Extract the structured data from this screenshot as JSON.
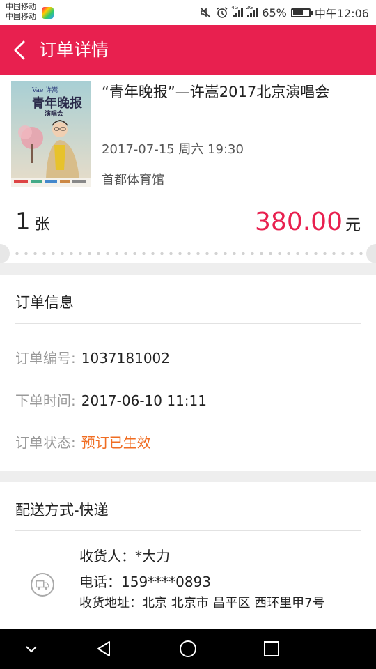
{
  "status_bar": {
    "carrier_1": "中国移动",
    "carrier_2": "中国移动",
    "network_1": "4G",
    "network_2": "2G",
    "battery_text": "65%",
    "battery_level": 0.65,
    "time": "中午12:06",
    "icons": [
      "mute-icon",
      "alarm-icon",
      "signal-icon",
      "battery-icon"
    ]
  },
  "header": {
    "title": "订单详情",
    "back_icon": "chevron-left-icon"
  },
  "event": {
    "poster_text_1": "Vae 许嵩",
    "poster_text_2": "青年晚报",
    "poster_text_3": "演唱会",
    "title": "“青年晚报”—许嵩2017北京演唱会",
    "datetime": "2017-07-15 周六 19:30",
    "venue": "首都体育馆",
    "quantity": "1",
    "quantity_unit": "张",
    "price": "380.00",
    "currency": "元"
  },
  "order_info": {
    "title": "订单信息",
    "rows": [
      {
        "label": "订单编号:",
        "value": "1037181002"
      },
      {
        "label": "下单时间:",
        "value": "2017-06-10 11:11"
      },
      {
        "label": "订单状态:",
        "value": "预订已生效"
      }
    ]
  },
  "delivery": {
    "title": "配送方式-快递",
    "icon": "delivery-truck-icon",
    "receiver": "收货人：*大力",
    "phone": "电话：159****0893",
    "address": "收货地址：北京 北京市 昌平区 西环里甲7号"
  },
  "colors": {
    "accent": "#e8204f",
    "status": "#f06d22",
    "muted": "#999999"
  },
  "nav_bar": {
    "icons": [
      "chevron-down-icon",
      "back-triangle-icon",
      "home-circle-icon",
      "recents-square-icon"
    ]
  }
}
